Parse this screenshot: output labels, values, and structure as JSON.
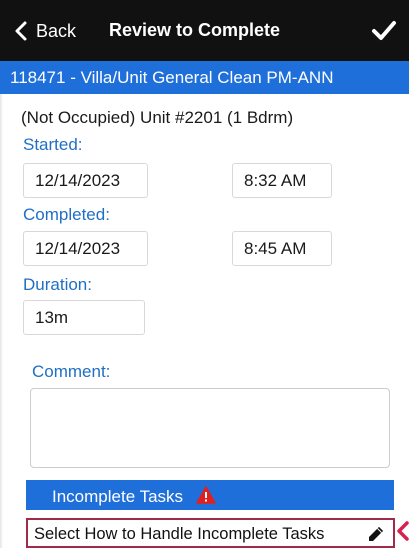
{
  "nav": {
    "back_label": "Back",
    "title": "Review to Complete"
  },
  "job": {
    "header": "118471 - Villa/Unit General Clean PM-ANN",
    "unit_info": "(Not Occupied) Unit #2201 (1 Bdrm)"
  },
  "started": {
    "label": "Started:",
    "date": "12/14/2023",
    "time": "8:32 AM"
  },
  "completed": {
    "label": "Completed:",
    "date": "12/14/2023",
    "time": "8:45 AM"
  },
  "duration": {
    "label": "Duration:",
    "value": "13m"
  },
  "comment": {
    "label": "Comment:",
    "value": ""
  },
  "incomplete": {
    "label": "Incomplete Tasks",
    "select_label": "Select How to Handle Incomplete Tasks"
  },
  "icons": {
    "back": "chevron-left-icon",
    "confirm": "checkmark-icon",
    "warning": "warning-triangle-icon",
    "edit": "pencil-icon",
    "callout": "arrow-left-icon"
  },
  "colors": {
    "navbar": "#111111",
    "accent_blue": "#1e6fd9",
    "label_blue": "#1f6fc6",
    "warning_red": "#e02020",
    "highlight_border": "#a12a4a",
    "callout_arrow": "#d6224f"
  }
}
